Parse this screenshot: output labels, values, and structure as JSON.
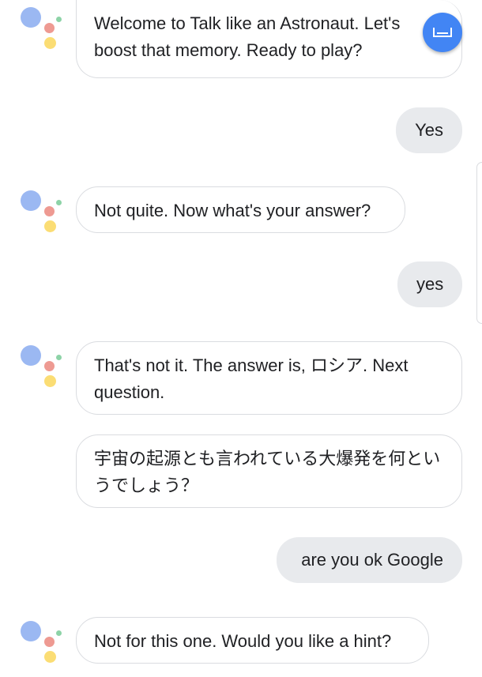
{
  "conversation": {
    "messages": [
      {
        "role": "assistant",
        "text": "Welcome to Talk like an Astronaut. Let's boost that memory. Ready to play?"
      },
      {
        "role": "user",
        "text": "Yes"
      },
      {
        "role": "assistant",
        "text": "Not quite. Now what's your answer?"
      },
      {
        "role": "user",
        "text": "yes"
      },
      {
        "role": "assistant",
        "text": "That's not it. The answer is, ロシア. Next question."
      },
      {
        "role": "assistant",
        "text": "宇宙の起源とも言われている大爆発を何というでしょう？"
      },
      {
        "role": "user",
        "text": "are you ok Google"
      },
      {
        "role": "assistant",
        "text": "Not for this one. Would you like a hint?"
      }
    ]
  },
  "controls": {
    "keyboard_button_icon": "keyboard-icon",
    "assistant_logo_icon": "google-assistant-logo-icon"
  },
  "colors": {
    "assistant_blue": "#9bb8f2",
    "assistant_red": "#ee9a92",
    "assistant_yellow": "#fbdd74",
    "assistant_green": "#8dd3a7",
    "fab_blue": "#4285f4",
    "user_bubble": "#e8eaed",
    "bot_bubble_border": "#dadce0"
  }
}
